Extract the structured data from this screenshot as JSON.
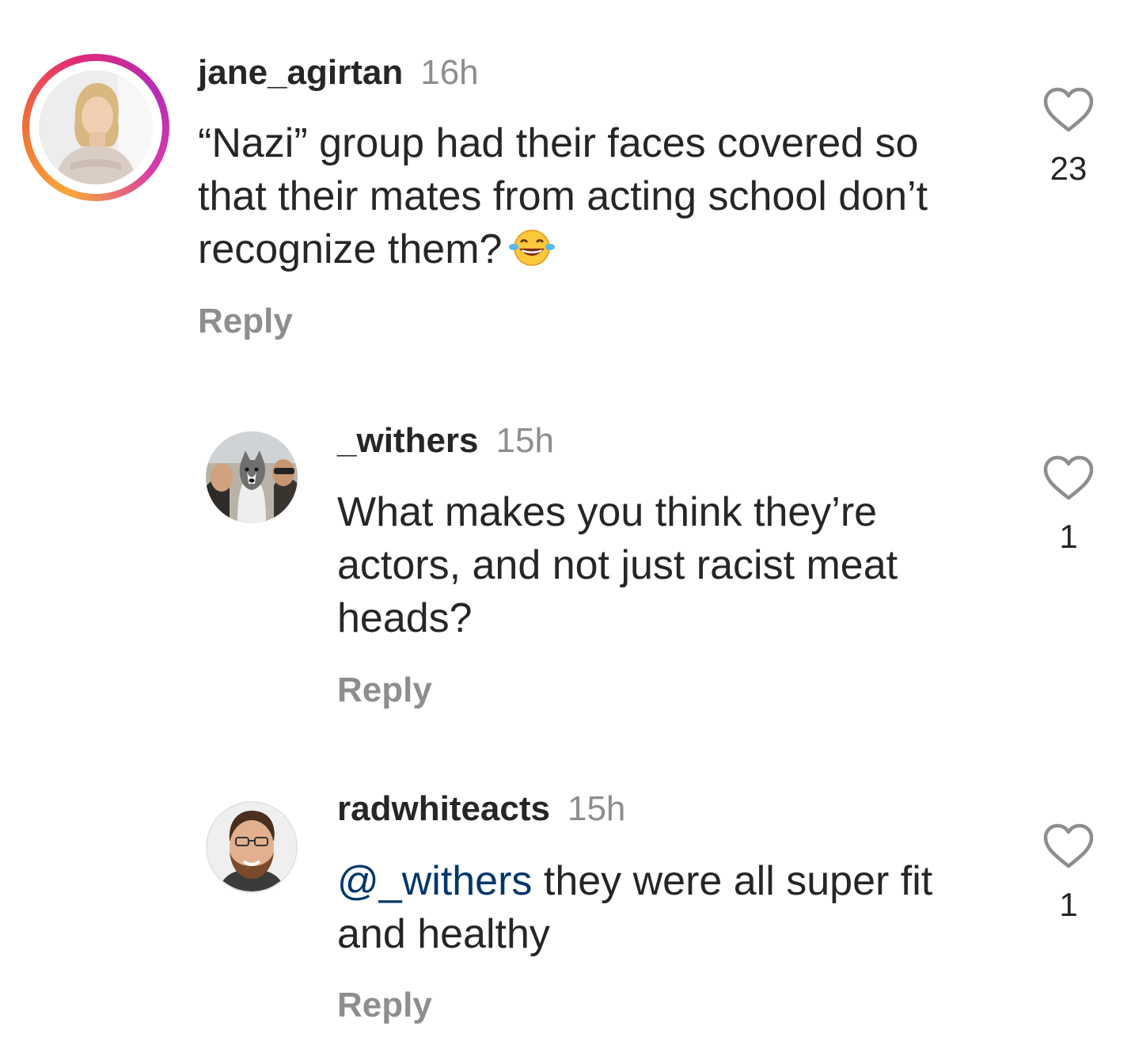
{
  "comments": [
    {
      "username": "jane_agirtan",
      "time": "16h",
      "text": "“Nazi” group had their faces covered so that their mates from acting school don’t recognize them?",
      "emoji": "face-with-tears-of-joy",
      "reply_label": "Reply",
      "likes": "23",
      "has_story_ring": true
    },
    {
      "username": "_withers",
      "time": "15h",
      "text": "What makes you think they’re actors, and not just racist meat heads?",
      "reply_label": "Reply",
      "likes": "1"
    },
    {
      "username": "radwhiteacts",
      "time": "15h",
      "mention": "@_withers",
      "text": " they were all super fit and healthy",
      "reply_label": "Reply",
      "likes": "1"
    }
  ],
  "colors": {
    "text": "#262626",
    "secondary": "#8e8e8e",
    "mention": "#00376b"
  }
}
